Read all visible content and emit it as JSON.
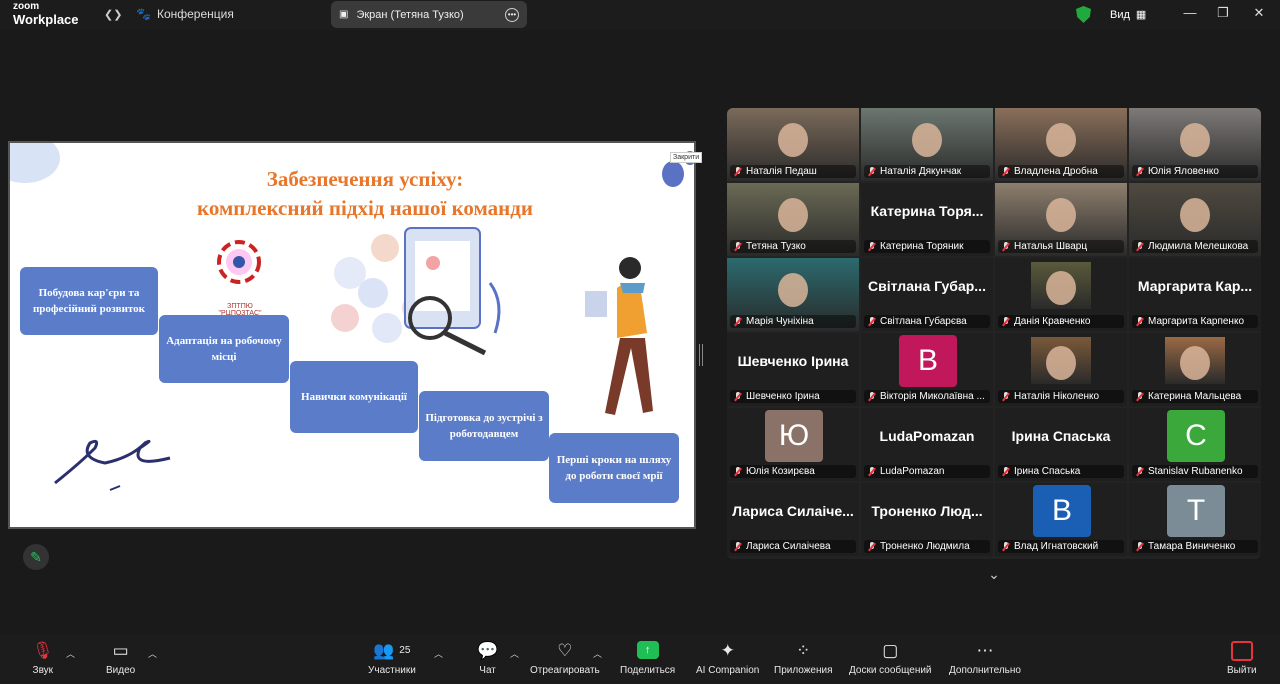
{
  "app": {
    "logo_top": "zoom",
    "logo_bottom": "Workplace",
    "meeting_title": "Конференция",
    "view_label": "Вид"
  },
  "share_pill": {
    "label": "Экран (Тетяна Тузко)"
  },
  "slide": {
    "title_line1": "Забезпечення успіху:",
    "title_line2": "комплексний підхід нашої команди",
    "closed_label": "Закрити",
    "steps": [
      "Побудова кар'єри та професійний розвиток",
      "Адаптація на робочому місці",
      "Навички комунікації",
      "Підготовка до зустрічі з роботодавцем",
      "Перші кроки на шляху до роботи своєї мрії"
    ],
    "logo_text": "ЗПТПЮ \"РЦПОЗТАС\""
  },
  "participants": [
    {
      "name": "Наталія Педаш",
      "kind": "video",
      "color": "#7a6a5a"
    },
    {
      "name": "Наталія Дякунчак",
      "kind": "video",
      "color": "#6c7770"
    },
    {
      "name": "Владлена Дробна",
      "kind": "video",
      "color": "#8a6f5a"
    },
    {
      "name": "Юлія Яловенко",
      "kind": "video",
      "color": "#7d7a78"
    },
    {
      "name": "Тетяна Тузко",
      "kind": "video",
      "color": "#6b6a55",
      "active": true
    },
    {
      "name": "Катерина Торяник",
      "kind": "text",
      "big": "Катерина Торя..."
    },
    {
      "name": "Наталья Шварц",
      "kind": "video",
      "color": "#8e7f6e"
    },
    {
      "name": "Людмила Мелешкова",
      "kind": "video",
      "color": "#4f4a40"
    },
    {
      "name": "Марія Чуніхіна",
      "kind": "video",
      "color": "#2b6a6e"
    },
    {
      "name": "Світлана Губарєва",
      "kind": "text",
      "big": "Світлана Губар..."
    },
    {
      "name": "Данія Кравченко",
      "kind": "photo",
      "color": "#5a5a3c"
    },
    {
      "name": "Маргарита Карпенко",
      "kind": "text",
      "big": "Маргарита Кар..."
    },
    {
      "name": "Шевченко Ірина",
      "kind": "text",
      "big": "Шевченко Ірина"
    },
    {
      "name": "Вікторія Миколаївна ...",
      "kind": "avatar",
      "letter": "В",
      "color": "#c0185a"
    },
    {
      "name": "Наталія Ніколенко",
      "kind": "photo",
      "color": "#7a5a3a"
    },
    {
      "name": "Катерина Мальцева",
      "kind": "photo",
      "color": "#9a6a45"
    },
    {
      "name": "Юлія Козирєва",
      "kind": "avatar",
      "letter": "Ю",
      "color": "#8a7268"
    },
    {
      "name": "LudaPomazan",
      "kind": "text",
      "big": "LudaPomazan"
    },
    {
      "name": "Ірина Спаська",
      "kind": "text",
      "big": "Ірина Спаська"
    },
    {
      "name": "Stanislav Rubanenko",
      "kind": "avatar",
      "letter": "С",
      "color": "#3aa83a"
    },
    {
      "name": "Лариса Силаічева",
      "kind": "text",
      "big": "Лариса Силаіче..."
    },
    {
      "name": "Троненко Людмила",
      "kind": "text",
      "big": "Троненко Люд..."
    },
    {
      "name": "Влад Игнатовский",
      "kind": "avatar",
      "letter": "В",
      "color": "#1a5fb4"
    },
    {
      "name": "Тамара Виниченко",
      "kind": "avatar",
      "letter": "Т",
      "color": "#7c8c96"
    }
  ],
  "toolbar": {
    "audio": "Звук",
    "video": "Видео",
    "participants": "Участники",
    "participants_count": "25",
    "chat": "Чат",
    "react": "Отреагировать",
    "share": "Поделиться",
    "ai": "AI Companion",
    "apps": "Приложения",
    "boards": "Доски сообщений",
    "more": "Дополнительно",
    "exit": "Выйти"
  }
}
